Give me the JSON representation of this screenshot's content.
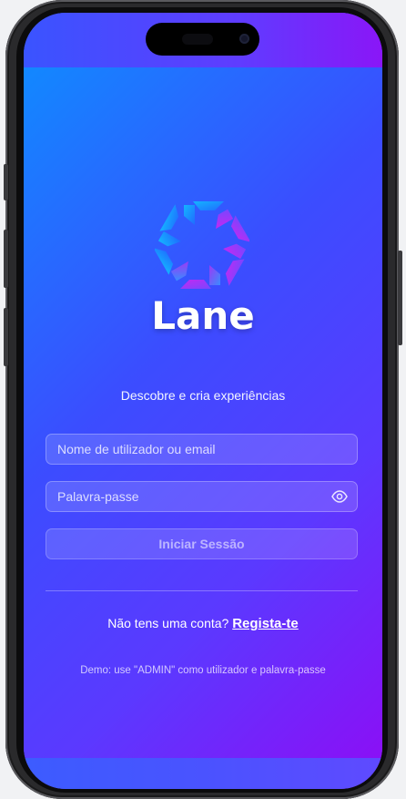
{
  "app": {
    "brand": "Lane",
    "tagline": "Descobre e cria experiências"
  },
  "login": {
    "username_placeholder": "Nome de utilizador ou email",
    "username_value": "",
    "password_placeholder": "Palavra-passe",
    "password_value": "",
    "submit_label": "Iniciar Sessão"
  },
  "signup": {
    "prompt": "Não tens uma conta?",
    "link_label": "Regista-te"
  },
  "demo_note": "Demo: use \"ADMIN\" como utilizador e palavra-passe",
  "icons": {
    "logo": "lane-logo-icon",
    "password_toggle": "eye-icon"
  },
  "colors": {
    "gradient_start": "#1288ff",
    "gradient_mid": "#3b4dff",
    "gradient_end": "#8a10f6",
    "logo_cyan": "#14b4ff",
    "logo_magenta": "#c229f2"
  }
}
